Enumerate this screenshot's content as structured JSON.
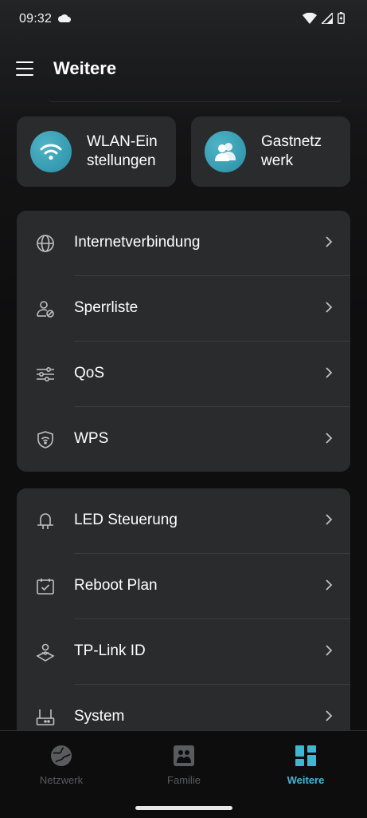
{
  "status": {
    "time": "09:32"
  },
  "header": {
    "title": "Weitere"
  },
  "quick_actions": [
    {
      "label": "WLAN-Ein\nstellungen",
      "icon": "wifi-icon"
    },
    {
      "label": "Gastnetz\nwerk",
      "icon": "guests-icon"
    }
  ],
  "group1": [
    {
      "label": "Internetverbindung",
      "icon": "globe-icon"
    },
    {
      "label": "Sperrliste",
      "icon": "blocked-user-icon"
    },
    {
      "label": "QoS",
      "icon": "sliders-icon"
    },
    {
      "label": "WPS",
      "icon": "shield-wifi-icon"
    }
  ],
  "group2": [
    {
      "label": "LED Steuerung",
      "icon": "led-lamp-icon"
    },
    {
      "label": "Reboot Plan",
      "icon": "calendar-check-icon"
    },
    {
      "label": "TP-Link ID",
      "icon": "account-id-icon"
    },
    {
      "label": "System",
      "icon": "router-icon"
    }
  ],
  "bottom_nav": [
    {
      "label": "Netzwerk",
      "icon": "globe-network-icon",
      "active": false
    },
    {
      "label": "Familie",
      "icon": "family-icon",
      "active": false
    },
    {
      "label": "Weitere",
      "icon": "grid-icon",
      "active": true
    }
  ],
  "colors": {
    "accent": "#3fb6d2",
    "card": "#2a2b2d",
    "background": "#141415",
    "icon_circle": "#3aa3b8"
  }
}
